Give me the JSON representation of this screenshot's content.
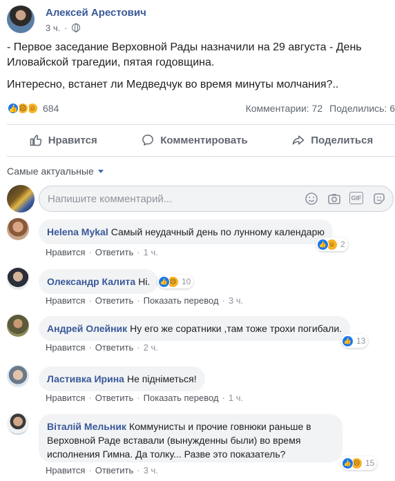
{
  "post": {
    "author": "Алексей Арестович",
    "time": "3 ч.",
    "dot": "·",
    "paragraphs": [
      "- Первое заседание Верховной Рады назначили на 29 августа - День Иловайской трагедии, пятая годовщина.",
      "Интересно, встанет ли Медведчук во время минуты молчания?.."
    ],
    "reactions_count": "684",
    "comments_stat": "Комментарии: 72",
    "shares_stat": "Поделились: 6"
  },
  "actions": {
    "like": "Нравится",
    "comment": "Комментировать",
    "share": "Поделиться"
  },
  "sort_label": "Самые актуальные",
  "composer": {
    "placeholder": "Напишите комментарий...",
    "icons": [
      "emoji-icon",
      "camera-icon",
      "gif-icon",
      "sticker-icon"
    ],
    "gif_text": "GIF"
  },
  "comment_actions": {
    "like": "Нравится",
    "reply": "Ответить",
    "translate": "Показать перевод",
    "sep": "·"
  },
  "comments": [
    {
      "name": "Helena Mykal",
      "text": "Самый неудачный день по лунному календарю",
      "time": "1 ч.",
      "reactions": "2",
      "translate": false
    },
    {
      "name": "Олександр Калита",
      "text": "Ні.",
      "time": "3 ч.",
      "reactions": "10",
      "translate": true
    },
    {
      "name": "Андрей Олейник",
      "text": "Ну его же соратники ,там тоже трохи погибали.",
      "time": "2 ч.",
      "reactions": "13",
      "translate": false
    },
    {
      "name": "Ластивка Ирина",
      "text": "Не підніметься!",
      "time": "1 ч.",
      "reactions": "",
      "translate": true
    },
    {
      "name": "Віталій Мельник",
      "text": "Коммунисты и прочие говнюки раньше в Верховной Раде вставали (вынужденны были) во время исполнения Гимна. Да толку... Разве это показатель?",
      "time": "3 ч.",
      "reactions": "15",
      "translate": false
    }
  ],
  "colors": {
    "link": "#385898",
    "like_blue": "#1877f2",
    "emoji_yellow": "#f7b125",
    "bubble_bg": "#f2f3f5"
  }
}
